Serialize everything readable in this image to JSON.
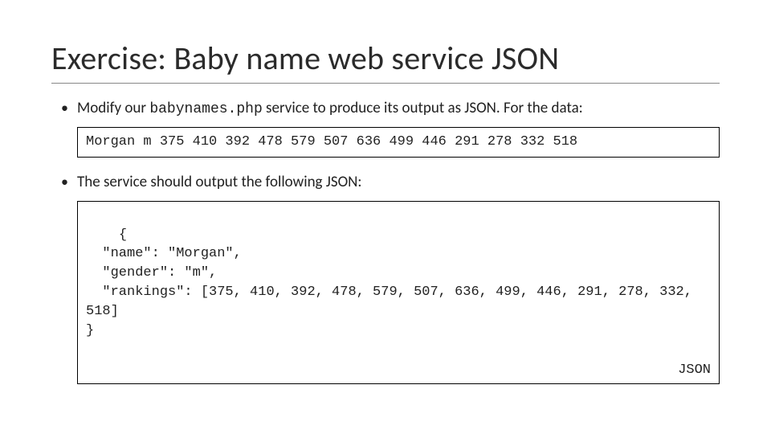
{
  "title": "Exercise: Baby name web service JSON",
  "bullet1": {
    "pre": "Modify our ",
    "code": "babynames.php",
    "post": " service to produce its output as JSON. For the data:"
  },
  "data_line": "Morgan m 375 410 392 478 579 507 636 499 446 291 278 332 518",
  "bullet2": "The service should output the following JSON:",
  "json_output": "{\n  \"name\": \"Morgan\",\n  \"gender\": \"m\",\n  \"rankings\": [375, 410, 392, 478, 579, 507, 636, 499, 446, 291, 278, 332, 518]\n}",
  "json_label": "JSON"
}
